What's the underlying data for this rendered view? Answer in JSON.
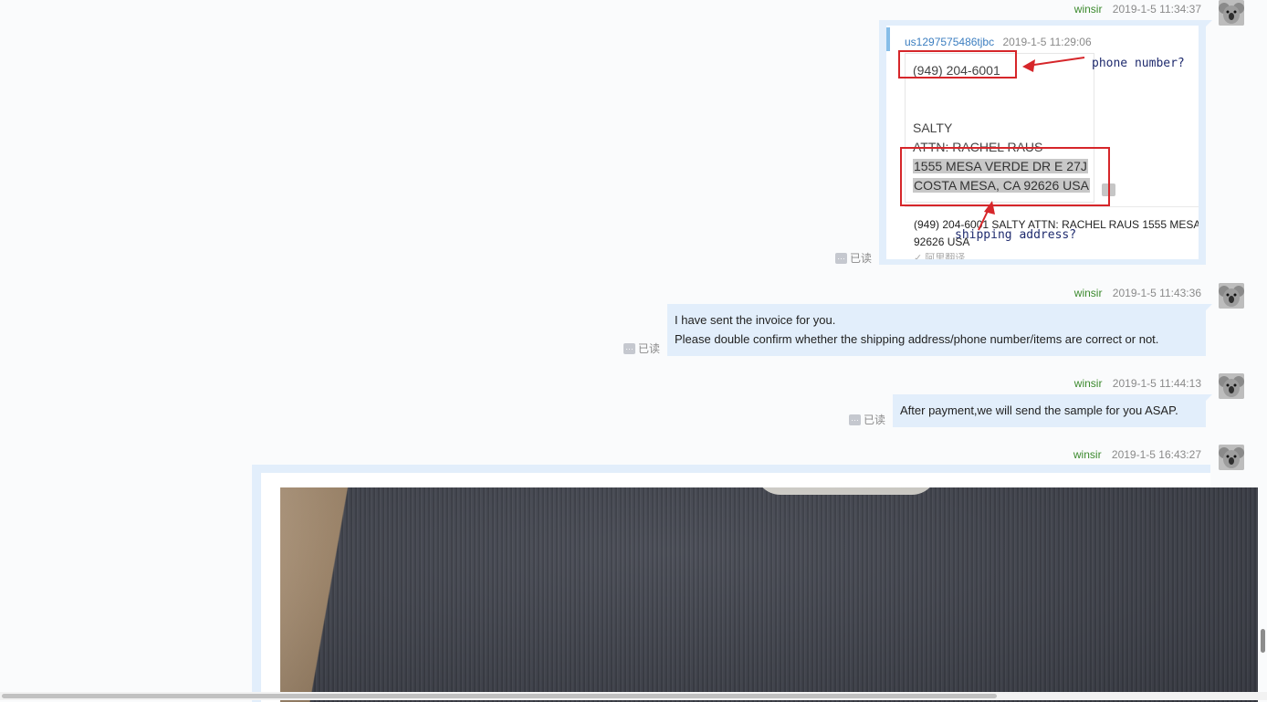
{
  "messages": [
    {
      "sender": "winsir",
      "time": "2019-1-5 11:34:37",
      "read": "已读",
      "quote": {
        "user": "us1297575486tjbc",
        "time": "2019-1-5 11:29:06",
        "note_lines": [
          "(949) 204-6001",
          "SALTY",
          "ATTN: RACHEL RAUS",
          "1555 MESA VERDE DR E 27J",
          "COSTA MESA, CA 92626 USA"
        ],
        "translation_lines": [
          "(949) 204-6001 SALTY ATTN: RACHEL RAUS 1555 MESA",
          "92626 USA"
        ],
        "translation_source": "✓ 阿里翻译"
      },
      "annotations": {
        "phone": "phone number?",
        "address": "shipping address?"
      }
    },
    {
      "sender": "winsir",
      "time": "2019-1-5 11:43:36",
      "read": "已读",
      "lines": [
        "I have sent the invoice for you.",
        "Please double confirm whether the shipping address/phone number/items are correct or not."
      ]
    },
    {
      "sender": "winsir",
      "time": "2019-1-5 11:44:13",
      "read": "已读",
      "lines": [
        "After payment,we will send the sample for you ASAP."
      ]
    },
    {
      "sender": "winsir",
      "time": "2019-1-5 16:43:27"
    }
  ],
  "icons": {
    "avatar": "koala-avatar-icon",
    "read": "read-receipt-icon",
    "copy": "copy-icon",
    "check": "check-icon"
  },
  "colors": {
    "bubble": "#e2eefb",
    "sender": "#3c8a2e",
    "annotation_red": "#d6262a",
    "annotation_text": "#1f2b6e"
  }
}
